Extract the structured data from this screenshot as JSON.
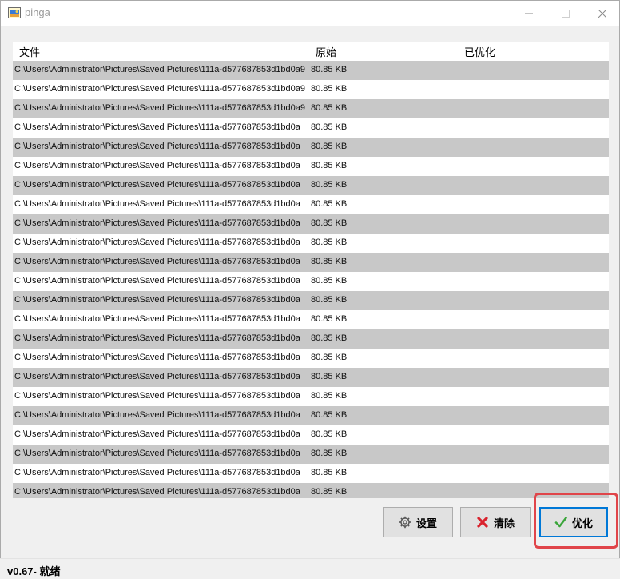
{
  "window": {
    "title": "pinga"
  },
  "list": {
    "columns": {
      "file": "文件",
      "original": "原始",
      "optimized": "已优化"
    },
    "rows": [
      {
        "path": "C:\\Users\\Administrator\\Pictures\\Saved Pictures\\111a-d577687853d1bd0a9",
        "original": "80.85 KB",
        "optimized": ""
      },
      {
        "path": "C:\\Users\\Administrator\\Pictures\\Saved Pictures\\111a-d577687853d1bd0a9",
        "original": "80.85 KB",
        "optimized": ""
      },
      {
        "path": "C:\\Users\\Administrator\\Pictures\\Saved Pictures\\111a-d577687853d1bd0a9",
        "original": "80.85 KB",
        "optimized": ""
      },
      {
        "path": "C:\\Users\\Administrator\\Pictures\\Saved Pictures\\111a-d577687853d1bd0a",
        "original": "80.85 KB",
        "optimized": ""
      },
      {
        "path": "C:\\Users\\Administrator\\Pictures\\Saved Pictures\\111a-d577687853d1bd0a",
        "original": "80.85 KB",
        "optimized": ""
      },
      {
        "path": "C:\\Users\\Administrator\\Pictures\\Saved Pictures\\111a-d577687853d1bd0a",
        "original": "80.85 KB",
        "optimized": ""
      },
      {
        "path": "C:\\Users\\Administrator\\Pictures\\Saved Pictures\\111a-d577687853d1bd0a",
        "original": "80.85 KB",
        "optimized": ""
      },
      {
        "path": "C:\\Users\\Administrator\\Pictures\\Saved Pictures\\111a-d577687853d1bd0a",
        "original": "80.85 KB",
        "optimized": ""
      },
      {
        "path": "C:\\Users\\Administrator\\Pictures\\Saved Pictures\\111a-d577687853d1bd0a",
        "original": "80.85 KB",
        "optimized": ""
      },
      {
        "path": "C:\\Users\\Administrator\\Pictures\\Saved Pictures\\111a-d577687853d1bd0a",
        "original": "80.85 KB",
        "optimized": ""
      },
      {
        "path": "C:\\Users\\Administrator\\Pictures\\Saved Pictures\\111a-d577687853d1bd0a",
        "original": "80.85 KB",
        "optimized": ""
      },
      {
        "path": "C:\\Users\\Administrator\\Pictures\\Saved Pictures\\111a-d577687853d1bd0a",
        "original": "80.85 KB",
        "optimized": ""
      },
      {
        "path": "C:\\Users\\Administrator\\Pictures\\Saved Pictures\\111a-d577687853d1bd0a",
        "original": "80.85 KB",
        "optimized": ""
      },
      {
        "path": "C:\\Users\\Administrator\\Pictures\\Saved Pictures\\111a-d577687853d1bd0a",
        "original": "80.85 KB",
        "optimized": ""
      },
      {
        "path": "C:\\Users\\Administrator\\Pictures\\Saved Pictures\\111a-d577687853d1bd0a",
        "original": "80.85 KB",
        "optimized": ""
      },
      {
        "path": "C:\\Users\\Administrator\\Pictures\\Saved Pictures\\111a-d577687853d1bd0a",
        "original": "80.85 KB",
        "optimized": ""
      },
      {
        "path": "C:\\Users\\Administrator\\Pictures\\Saved Pictures\\111a-d577687853d1bd0a",
        "original": "80.85 KB",
        "optimized": ""
      },
      {
        "path": "C:\\Users\\Administrator\\Pictures\\Saved Pictures\\111a-d577687853d1bd0a",
        "original": "80.85 KB",
        "optimized": ""
      },
      {
        "path": "C:\\Users\\Administrator\\Pictures\\Saved Pictures\\111a-d577687853d1bd0a",
        "original": "80.85 KB",
        "optimized": ""
      },
      {
        "path": "C:\\Users\\Administrator\\Pictures\\Saved Pictures\\111a-d577687853d1bd0a",
        "original": "80.85 KB",
        "optimized": ""
      },
      {
        "path": "C:\\Users\\Administrator\\Pictures\\Saved Pictures\\111a-d577687853d1bd0a",
        "original": "80.85 KB",
        "optimized": ""
      },
      {
        "path": "C:\\Users\\Administrator\\Pictures\\Saved Pictures\\111a-d577687853d1bd0a",
        "original": "80.85 KB",
        "optimized": ""
      },
      {
        "path": "C:\\Users\\Administrator\\Pictures\\Saved Pictures\\111a-d577687853d1bd0a",
        "original": "80.85 KB",
        "optimized": ""
      }
    ]
  },
  "buttons": {
    "settings": {
      "label": "设置",
      "icon": "gear-icon"
    },
    "clear": {
      "label": "清除",
      "icon": "red-x-icon"
    },
    "optimize": {
      "label": "优化",
      "icon": "green-check-icon"
    }
  },
  "status": {
    "text": "v0.67- 就绪"
  },
  "colors": {
    "highlight": "#e0454a",
    "focus_border": "#0078d7",
    "row_alt": "#c8c8c8"
  }
}
